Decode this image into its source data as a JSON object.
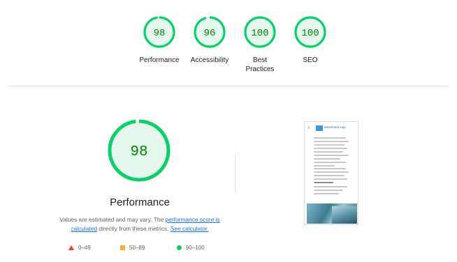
{
  "colors": {
    "pass": "#0cce6b",
    "pass_text": "#008800",
    "pass_fill": "#e5f8ee",
    "average": "#ffaa33",
    "fail": "#ff3333",
    "link": "#1a73e8"
  },
  "summary": {
    "gauges": [
      {
        "label": "Performance",
        "score": "98",
        "fraction": 0.98
      },
      {
        "label": "Accessibility",
        "score": "96",
        "fraction": 0.96
      },
      {
        "label": "Best Practices",
        "score": "100",
        "fraction": 1.0
      },
      {
        "label": "SEO",
        "score": "100",
        "fraction": 1.0
      }
    ]
  },
  "performance": {
    "score": "98",
    "fraction": 0.98,
    "title": "Performance",
    "desc_prefix": "Values are estimated and may vary. The ",
    "desc_link1": "performance score is calculated",
    "desc_middle": " directly from these metrics. ",
    "desc_link2": "See calculator."
  },
  "legend": {
    "fail": "0–49",
    "average": "50–89",
    "pass": "90–100"
  },
  "screenshot": {
    "brand": "Movement Icep",
    "menu_icon": "hamburger-icon"
  }
}
